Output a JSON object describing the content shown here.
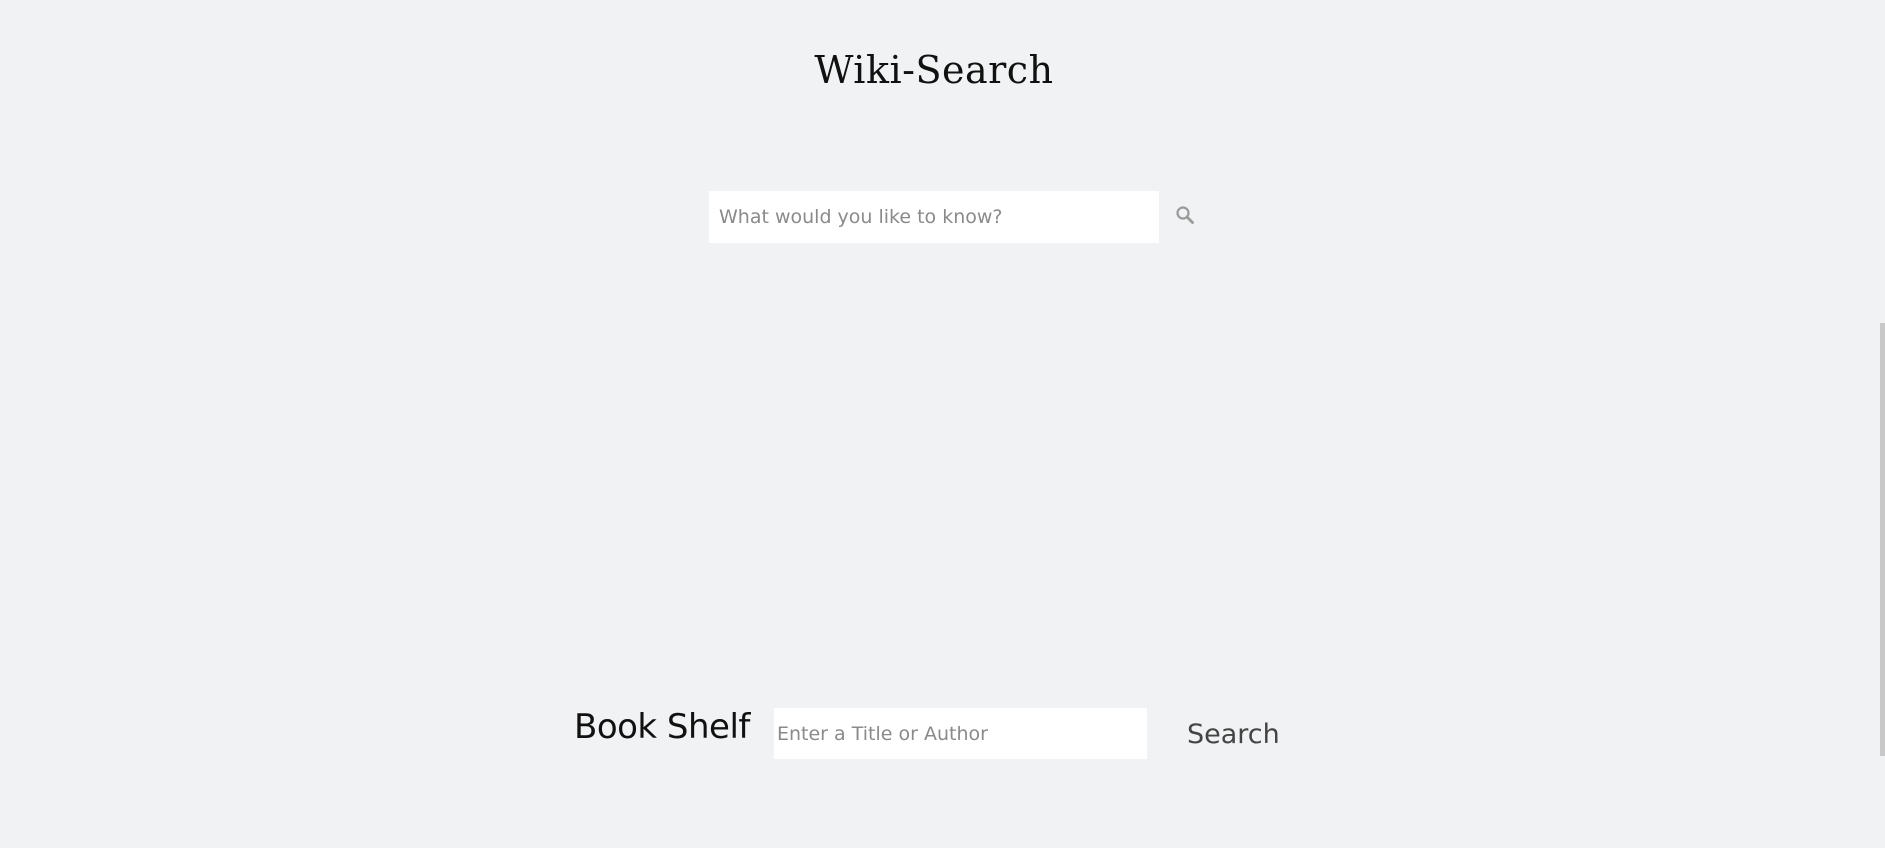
{
  "wiki": {
    "title": "Wiki-Search",
    "search_placeholder": "What would you like to know?",
    "search_value": "",
    "search_icon": "search-icon"
  },
  "book_shelf": {
    "title": "Book Shelf",
    "search_placeholder": "Enter a Title or Author",
    "search_value": "",
    "search_button_label": "Search"
  },
  "colors": {
    "background": "#f1f2f3",
    "input_background": "#ffffff",
    "placeholder": "#8a8a8a",
    "icon": "#9a9a9a"
  }
}
